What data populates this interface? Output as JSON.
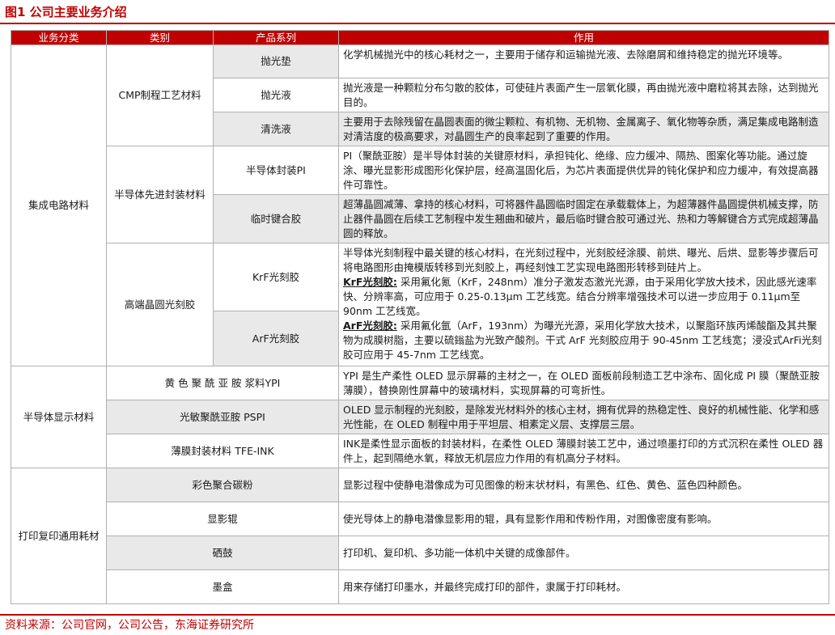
{
  "figure": {
    "title": "图1 公司主要业务介绍"
  },
  "table": {
    "headers": [
      "业务分类",
      "类别",
      "产品系列",
      "作用"
    ],
    "ic": {
      "name": "集成电路材料",
      "cmp": {
        "name": "CMP制程工艺材料",
        "rows": [
          {
            "product": "抛光垫",
            "use": "化学机械抛光中的核心耗材之一，主要用于储存和运输抛光液、去除磨屑和维持稳定的抛光环境等。"
          },
          {
            "product": "抛光液",
            "use": "抛光液是一种颗粒分布匀散的胶体，可使硅片表面产生一层氧化膜，再由抛光液中磨粒将其去除，达到抛光目的。"
          },
          {
            "product": "清洗液",
            "use": "主要用于去除残留在晶圆表面的微尘颗粒、有机物、无机物、金属离子、氧化物等杂质，满足集成电路制造对清洁度的极高要求，对晶圆生产的良率起到了重要的作用。"
          }
        ]
      },
      "packaging": {
        "name": "半导体先进封装材料",
        "rows": [
          {
            "product": "半导体封装PI",
            "use": "PI（聚酰亚胺）是半导体封装的关键原材料，承担钝化、绝缘、应力缓冲、隔热、图案化等功能。通过旋涂、曝光显影形成图形化保护层，经高温固化后，为芯片表面提供优异的钝化保护和应力缓冲，有效提高器件可靠性。"
          },
          {
            "product": "临时键合胶",
            "use": "超薄晶圆减薄、拿持的核心材料，可将器件晶圆临时固定在承载载体上，为超薄器件晶圆提供机械支撑，防止器件晶圆在后续工艺制程中发生翘曲和破片，最后临时键合胶可通过光、热和力等解键合方式完成超薄晶圆的释放。"
          }
        ]
      },
      "photoresist": {
        "name": "高端晶圆光刻胶",
        "products": [
          "KrF光刻胶",
          "ArF光刻胶"
        ],
        "intro": "半导体光刻制程中最关键的核心材料，在光刻过程中，光刻胶经涂膜、前烘、曝光、后烘、显影等步骤后可将电路图形由掩模版转移到光刻胶上，再经刻蚀工艺实现电路图形转移到硅片上。",
        "krf_label": "KrF光刻胶:",
        "krf_text": "采用氟化氪（KrF，248nm）准分子激发态激光光源，由于采用化学放大技术，因此感光速率快、分辨率高，可应用于 0.25-0.13μm 工艺线宽。结合分辨率增强技术可以进一步应用于 0.11μm至 90nm 工艺线宽。",
        "arf_label": "ArF光刻胶:",
        "arf_text": "采用氟化氩（ArF，193nm）为曝光光源，采用化学放大技术，以聚脂环族丙烯酸酯及其共聚物为成膜树脂，主要以硫鎓盐为光致产酸剂。干式 ArF 光刻胶应用于 90-45nm 工艺线宽；浸没式ArFi光刻胶可应用于 45-7nm 工艺线宽。"
      }
    },
    "display": {
      "name": "半导体显示材料",
      "rows": [
        {
          "product": "黄 色 聚 酰 亚 胺 浆料YPI",
          "use": "YPI 是生产柔性 OLED 显示屏幕的主材之一，在 OLED 面板前段制造工艺中涂布、固化成 PI 膜（聚酰亚胺薄膜），替换刚性屏幕中的玻璃材料，实现屏幕的可弯折性。"
        },
        {
          "product": "光敏聚酰亚胺 PSPI",
          "use": "OLED 显示制程的光刻胶，是除发光材料外的核心主材，拥有优异的热稳定性、良好的机械性能、化学和感光性能，在 OLED 制程中用于平坦层、相素定义层、支撑层三层。"
        },
        {
          "product": "薄膜封装材料 TFE-INK",
          "use": "INK是柔性显示面板的封装材料，在柔性 OLED 薄膜封装工艺中，通过喷墨打印的方式沉积在柔性 OLED 器件上，起到隔绝水氧，释放无机层应力作用的有机高分子材料。"
        }
      ]
    },
    "printing": {
      "name": "打印复印通用耗材",
      "rows": [
        {
          "product": "彩色聚合碳粉",
          "use": "显影过程中使静电潜像成为可见图像的粉末状材料，有黑色、红色、黄色、蓝色四种颜色。"
        },
        {
          "product": "显影辊",
          "use": "使光导体上的静电潜像显影用的辊，具有显影作用和传粉作用，对图像密度有影响。"
        },
        {
          "product": "硒鼓",
          "use": "打印机、复印机、多功能一体机中关键的成像部件。"
        },
        {
          "product": "墨盒",
          "use": "用来存储打印墨水，并最终完成打印的部件，隶属于打印耗材。"
        }
      ]
    }
  },
  "source": "资料来源：公司官网，公司公告，东海证券研究所",
  "colors": {
    "accent": "#c00000",
    "row_shade": "#e9e9e9",
    "border": "#b0b0b0"
  }
}
